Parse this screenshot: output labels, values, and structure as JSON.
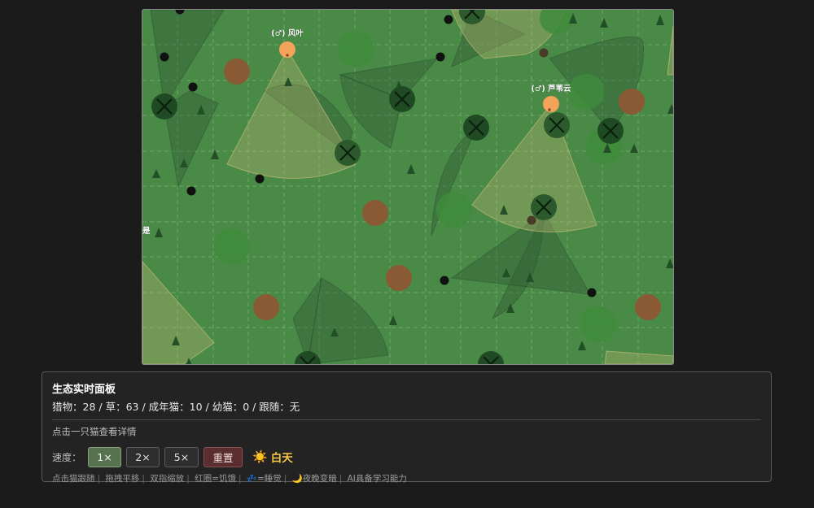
{
  "map": {
    "background": "#4a8a47",
    "cats": [
      {
        "label": "(♂) 风叶",
        "color": "#f4a45a"
      },
      {
        "label": "(♂) 芦苇云",
        "color": "#f4a45a"
      }
    ],
    "edge_label": "是"
  },
  "panel": {
    "title": "生态实时面板",
    "stats": "猎物：28 / 草：63 / 成年猫：10 / 幼猫：0 / 跟随：无",
    "hint": "点击一只猫查看详情",
    "speed_label": "速度：",
    "speed_buttons": [
      "1×",
      "2×",
      "5×"
    ],
    "active_speed": "1×",
    "reset_label": "重置",
    "day_icon": "☀️",
    "day_label": "白天",
    "legend": [
      "点击猫跟随",
      "拖拽平移",
      "双指缩放",
      "红圈=饥饿",
      "💤=睡觉",
      "🌙夜晚变暗",
      "AI具备学习能力"
    ]
  }
}
